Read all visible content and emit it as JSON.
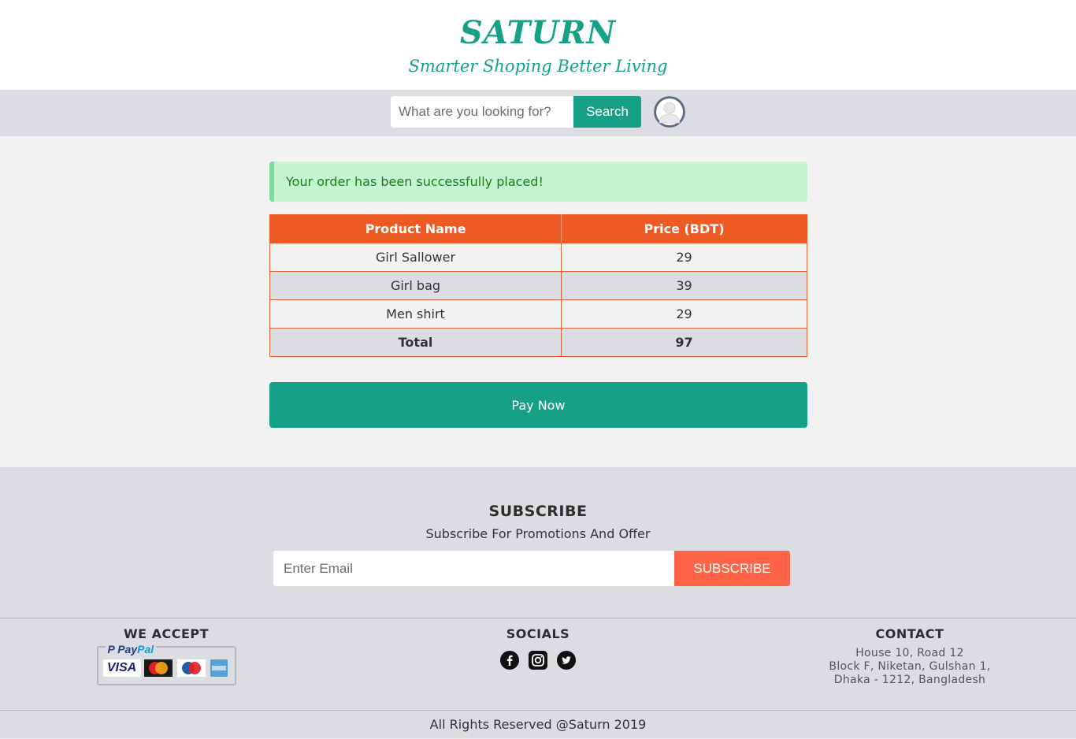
{
  "header": {
    "brand": "SATURN",
    "tagline": "Smarter Shoping Better Living"
  },
  "search": {
    "placeholder": "What are you looking for?",
    "button_label": "Search"
  },
  "alert": {
    "message": "Your order has been successfully placed!"
  },
  "order_table": {
    "columns": [
      "Product Name",
      "Price (BDT)"
    ],
    "rows": [
      {
        "name": "Girl Sallower",
        "price": "29"
      },
      {
        "name": "Girl bag",
        "price": "39"
      },
      {
        "name": "Men shirt",
        "price": "29"
      }
    ],
    "total_label": "Total",
    "total_value": "97"
  },
  "pay_button": "Pay Now",
  "subscribe": {
    "title": "SUBSCRIBE",
    "subtitle": "Subscribe For Promotions And Offer",
    "email_placeholder": "Enter Email",
    "button_label": "SUBSCRIBE"
  },
  "footer": {
    "accept_title": "WE ACCEPT",
    "payment_icons": [
      "paypal-icon",
      "visa-icon",
      "mastercard-icon",
      "maestro-icon",
      "amex-icon"
    ],
    "socials_title": "SOCIALS",
    "social_icons": [
      "facebook-icon",
      "instagram-icon",
      "twitter-icon"
    ],
    "contact_title": "CONTACT",
    "address_line1": "House 10, Road 12",
    "address_line2": "Block F, Niketan, Gulshan 1,",
    "address_line3": "Dhaka - 1212, Bangladesh",
    "copyright": "All Rights Reserved @Saturn 2019"
  },
  "colors": {
    "brand": "#16a085",
    "table_header": "#ee5a24",
    "subscribe_button": "#ff6348",
    "alert_bg": "#c4f4d0"
  }
}
